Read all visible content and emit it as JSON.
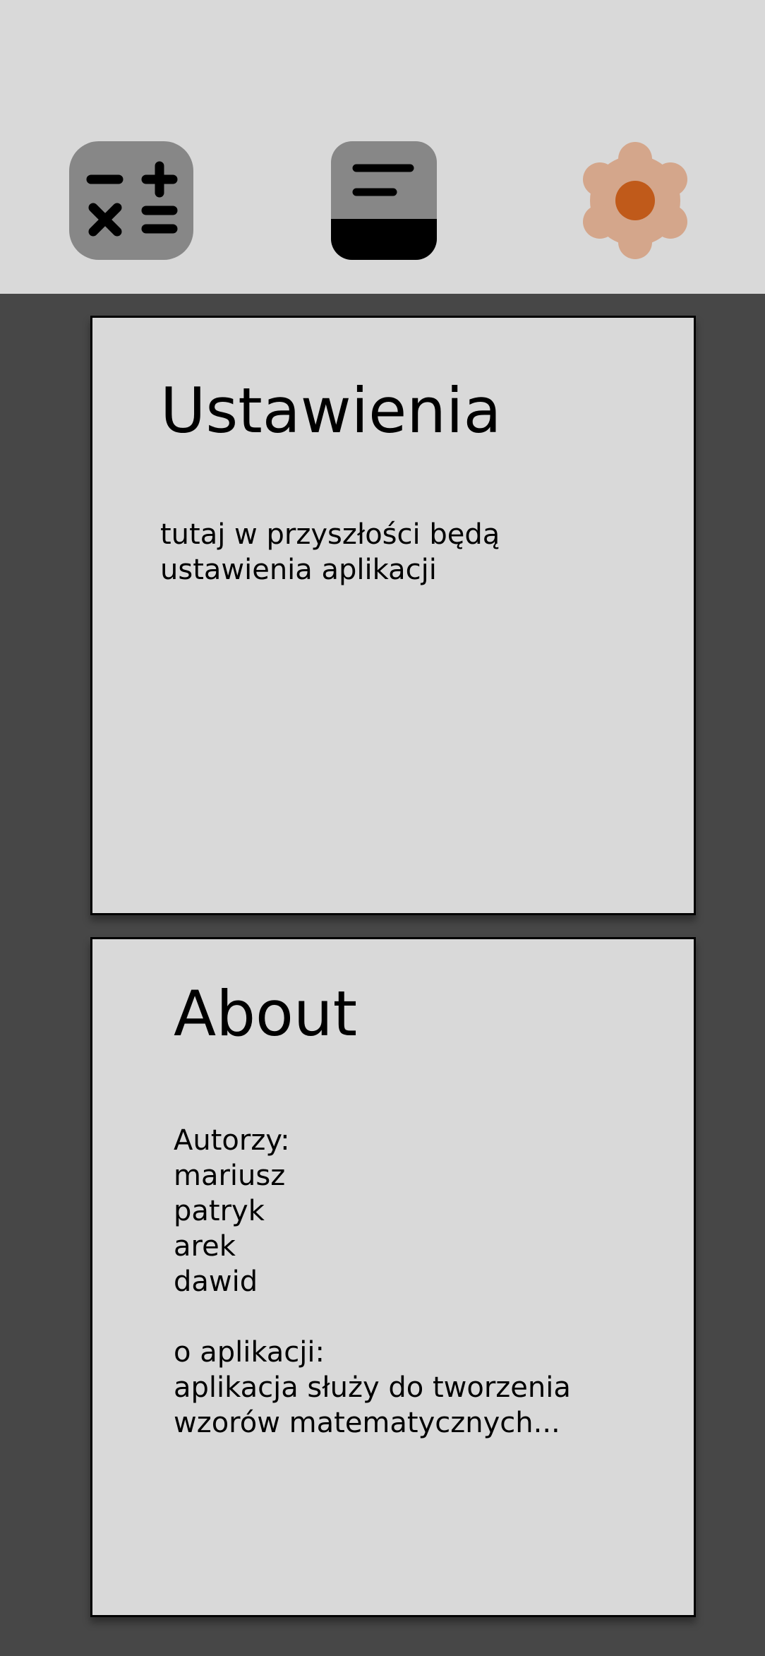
{
  "toolbar": {
    "calculator": {
      "icon": "calculator-icon",
      "color": "#878787"
    },
    "notes": {
      "icon": "notes-icon",
      "color": "#878787"
    },
    "settings": {
      "icon": "gear-icon",
      "color": "#d4a68b",
      "accent": "#c05a1a",
      "active": true
    }
  },
  "settings_card": {
    "title": "Ustawienia",
    "body": "tutaj w przyszłości będą\nustawienia aplikacji"
  },
  "about_card": {
    "title": "About",
    "body": "Autorzy:\nmariusz\npatryk\narek\ndawid\n\no aplikacji:\naplikacja służy do tworzenia\nwzorów matematycznych..."
  },
  "colors": {
    "top_bar": "#d9d9d9",
    "background": "#474747",
    "card": "#d9d9d9"
  }
}
